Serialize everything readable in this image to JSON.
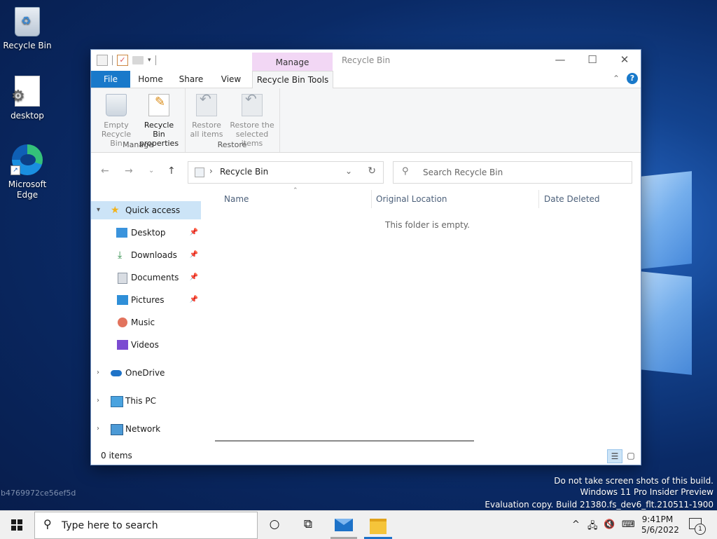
{
  "desktop": {
    "icons": [
      {
        "label": "Recycle Bin"
      },
      {
        "label": "desktop"
      },
      {
        "label": "Microsoft Edge"
      }
    ],
    "watermark": {
      "line1": "Do not take screen shots of this build.",
      "line2": "Windows 11 Pro Insider Preview",
      "line3": "Evaluation copy. Build 21380.fs_dev6_flt.210511-1900"
    },
    "hash": "b4769972ce56ef5d"
  },
  "window": {
    "title": "Recycle Bin",
    "context_tab": "Manage",
    "caption": {
      "minimize": "—",
      "maximize": "☐",
      "close": "✕"
    },
    "tabs": {
      "file": "File",
      "home": "Home",
      "share": "Share",
      "view": "View",
      "tools": "Recycle Bin Tools"
    },
    "ribbon": {
      "manage_group": "Manage",
      "restore_group": "Restore",
      "empty_line1": "Empty",
      "empty_line2": "Recycle Bin",
      "props_line1": "Recycle Bin",
      "props_line2": "properties",
      "restore_all_line1": "Restore",
      "restore_all_line2": "all items",
      "restore_sel_line1": "Restore the",
      "restore_sel_line2": "selected items"
    },
    "address": {
      "path": "Recycle Bin",
      "search_placeholder": "Search Recycle Bin"
    },
    "nav": {
      "quick_access": "Quick access",
      "items": [
        {
          "label": "Desktop",
          "pinned": true
        },
        {
          "label": "Downloads",
          "pinned": true
        },
        {
          "label": "Documents",
          "pinned": true
        },
        {
          "label": "Pictures",
          "pinned": true
        },
        {
          "label": "Music",
          "pinned": false
        },
        {
          "label": "Videos",
          "pinned": false
        }
      ],
      "onedrive": "OneDrive",
      "this_pc": "This PC",
      "network": "Network"
    },
    "columns": {
      "name": "Name",
      "original_location": "Original Location",
      "date_deleted": "Date Deleted"
    },
    "empty_message": "This folder is empty.",
    "status": "0 items"
  },
  "taskbar": {
    "search_placeholder": "Type here to search",
    "time": "9:41PM",
    "date": "5/6/2022",
    "notification_count": "1"
  },
  "colors": {
    "accent": "#1979ca",
    "context_tab": "#f2d7f5",
    "selection": "#cce4f7"
  }
}
